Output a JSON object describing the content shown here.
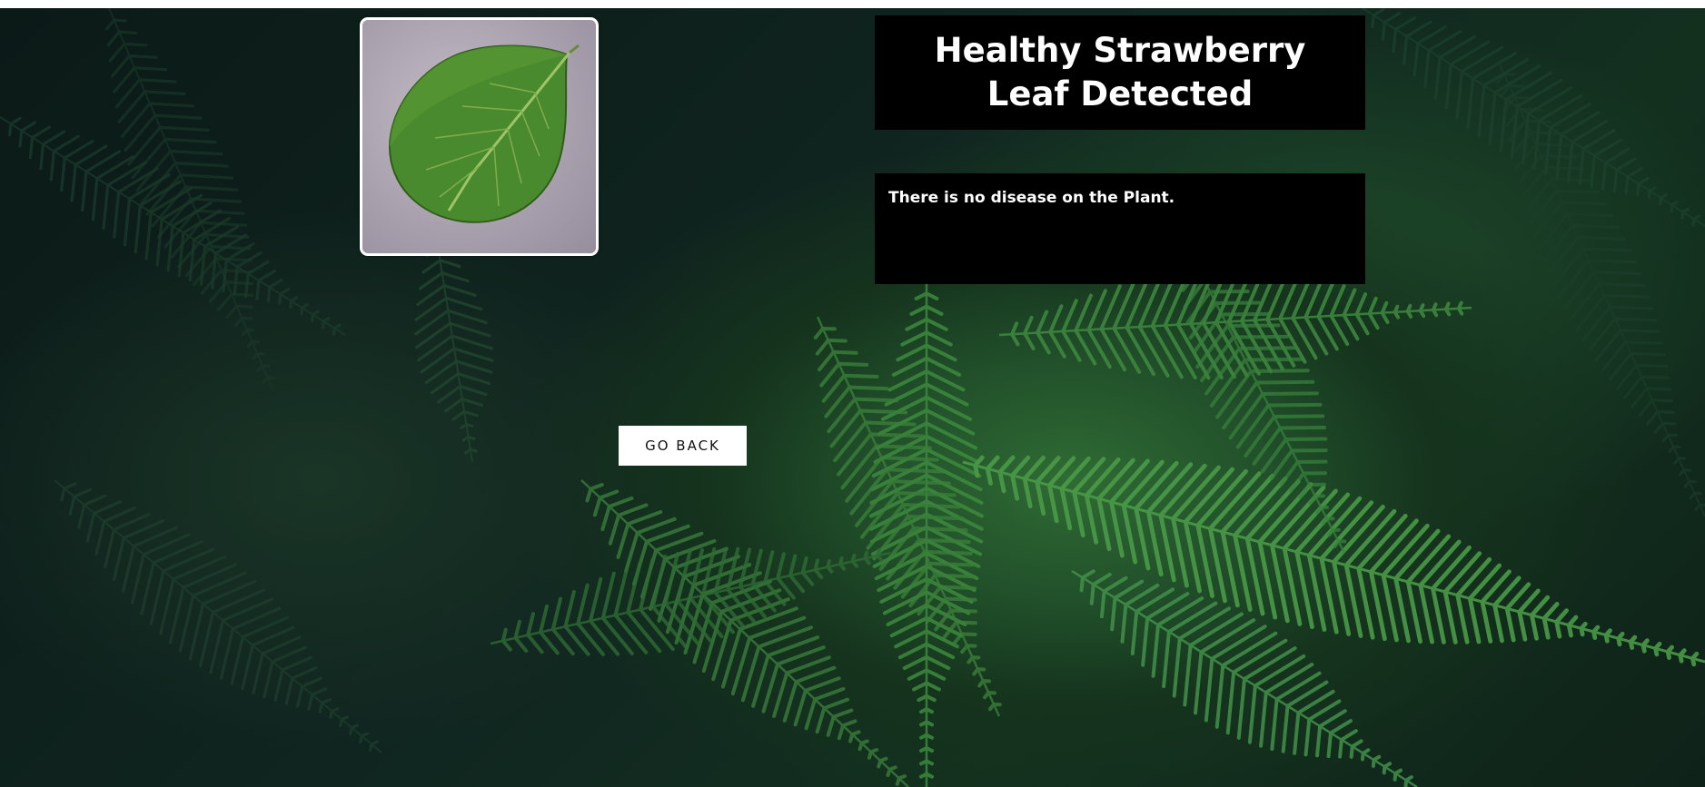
{
  "result": {
    "title": "Healthy Strawberry Leaf Detected",
    "description": "There is no disease on the Plant."
  },
  "actions": {
    "go_back_label": "GO BACK"
  },
  "colors": {
    "panel_background": "#000000",
    "panel_text": "#ffffff",
    "button_background": "#ffffff",
    "button_text": "#111111",
    "background_dark": "#0b1a17",
    "fern_green": "#2f6b34"
  },
  "images": {
    "background": "fern-foliage-background",
    "uploaded_leaf": "strawberry-leaf-photo"
  }
}
